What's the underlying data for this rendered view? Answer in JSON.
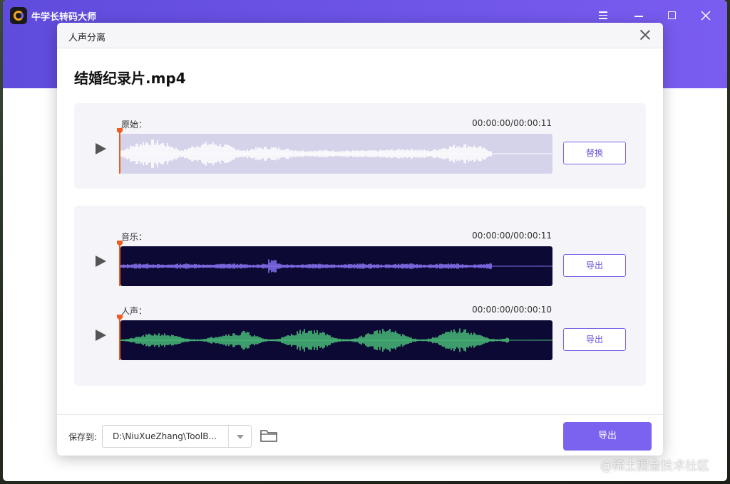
{
  "app": {
    "title": "牛学长转码大师"
  },
  "dialog": {
    "title": "人声分离",
    "file_name": "结婚纪录片.mp4"
  },
  "tracks": {
    "original": {
      "label": "原始：",
      "time": "00:00:00/00:00:11",
      "action_label": "替换",
      "wave_bg": "#d4d3ea",
      "wave_color": "#ffffff"
    },
    "music": {
      "label": "音乐：",
      "time": "00:00:00/00:00:11",
      "action_label": "导出",
      "wave_bg": "#0c0a35",
      "wave_color": "#8a74f5"
    },
    "vocal": {
      "label": "人声：",
      "time": "00:00:00/00:00:10",
      "action_label": "导出",
      "wave_bg": "#0c0a35",
      "wave_color": "#4cc27a"
    }
  },
  "footer": {
    "save_label": "保存到:",
    "path_value": "D:\\NiuXueZhang\\ToolB...",
    "export_label": "导出"
  },
  "watermark": "@稀土掘金技术社区",
  "colors": {
    "accent": "#7c63ef",
    "playhead": "#f25b1d"
  }
}
